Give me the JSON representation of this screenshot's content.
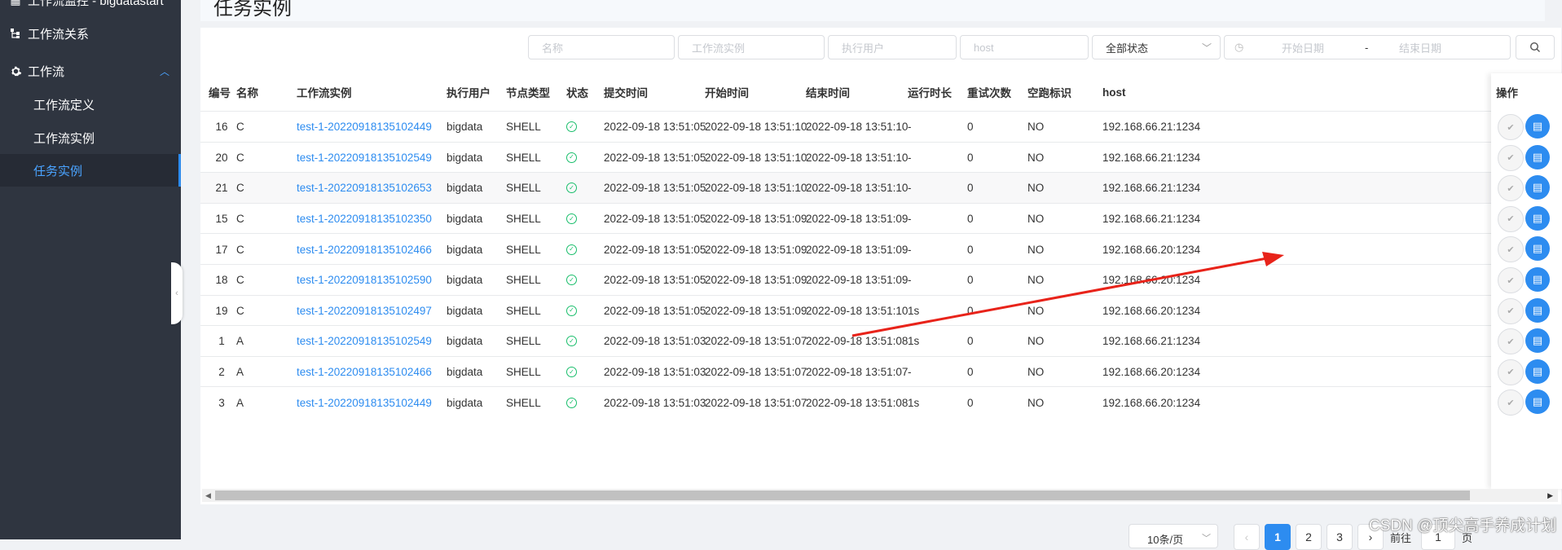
{
  "sidebar": {
    "top_partial": "工作流监控 - bigdatastart",
    "items": [
      {
        "label": "工作流关系",
        "icon": "relation-icon"
      },
      {
        "label": "工作流",
        "icon": "gear-icon"
      }
    ],
    "sub_items": [
      {
        "label": "工作流定义",
        "active": false
      },
      {
        "label": "工作流实例",
        "active": false
      },
      {
        "label": "任务实例",
        "active": true
      }
    ]
  },
  "page_title": "任务实例",
  "filters": {
    "name_placeholder": "名称",
    "process_instance_placeholder": "工作流实例",
    "executor_placeholder": "执行用户",
    "host_placeholder": "host",
    "state_select": "全部状态",
    "start_date_placeholder": "开始日期",
    "date_separator": "-",
    "end_date_placeholder": "结束日期"
  },
  "table": {
    "headers": [
      "编号",
      "名称",
      "工作流实例",
      "执行用户",
      "节点类型",
      "状态",
      "提交时间",
      "开始时间",
      "结束时间",
      "运行时长",
      "重试次数",
      "空跑标识",
      "host",
      "操作"
    ],
    "rows": [
      {
        "id": "16",
        "name": "C",
        "instance": "test-1-20220918135102449",
        "user": "bigdata",
        "type": "SHELL",
        "submit": "2022-09-18 13:51:05",
        "start": "2022-09-18 13:51:10",
        "end": "2022-09-18 13:51:10",
        "duration": "-",
        "retry": "0",
        "dry": "NO",
        "host": "192.168.66.21:1234"
      },
      {
        "id": "20",
        "name": "C",
        "instance": "test-1-20220918135102549",
        "user": "bigdata",
        "type": "SHELL",
        "submit": "2022-09-18 13:51:05",
        "start": "2022-09-18 13:51:10",
        "end": "2022-09-18 13:51:10",
        "duration": "-",
        "retry": "0",
        "dry": "NO",
        "host": "192.168.66.21:1234"
      },
      {
        "id": "21",
        "name": "C",
        "instance": "test-1-20220918135102653",
        "user": "bigdata",
        "type": "SHELL",
        "submit": "2022-09-18 13:51:05",
        "start": "2022-09-18 13:51:10",
        "end": "2022-09-18 13:51:10",
        "duration": "-",
        "retry": "0",
        "dry": "NO",
        "host": "192.168.66.21:1234"
      },
      {
        "id": "15",
        "name": "C",
        "instance": "test-1-20220918135102350",
        "user": "bigdata",
        "type": "SHELL",
        "submit": "2022-09-18 13:51:05",
        "start": "2022-09-18 13:51:09",
        "end": "2022-09-18 13:51:09",
        "duration": "-",
        "retry": "0",
        "dry": "NO",
        "host": "192.168.66.21:1234"
      },
      {
        "id": "17",
        "name": "C",
        "instance": "test-1-20220918135102466",
        "user": "bigdata",
        "type": "SHELL",
        "submit": "2022-09-18 13:51:05",
        "start": "2022-09-18 13:51:09",
        "end": "2022-09-18 13:51:09",
        "duration": "-",
        "retry": "0",
        "dry": "NO",
        "host": "192.168.66.20:1234"
      },
      {
        "id": "18",
        "name": "C",
        "instance": "test-1-20220918135102590",
        "user": "bigdata",
        "type": "SHELL",
        "submit": "2022-09-18 13:51:05",
        "start": "2022-09-18 13:51:09",
        "end": "2022-09-18 13:51:09",
        "duration": "-",
        "retry": "0",
        "dry": "NO",
        "host": "192.168.66.20:1234"
      },
      {
        "id": "19",
        "name": "C",
        "instance": "test-1-20220918135102497",
        "user": "bigdata",
        "type": "SHELL",
        "submit": "2022-09-18 13:51:05",
        "start": "2022-09-18 13:51:09",
        "end": "2022-09-18 13:51:10",
        "duration": "1s",
        "retry": "0",
        "dry": "NO",
        "host": "192.168.66.20:1234"
      },
      {
        "id": "1",
        "name": "A",
        "instance": "test-1-20220918135102549",
        "user": "bigdata",
        "type": "SHELL",
        "submit": "2022-09-18 13:51:03",
        "start": "2022-09-18 13:51:07",
        "end": "2022-09-18 13:51:08",
        "duration": "1s",
        "retry": "0",
        "dry": "NO",
        "host": "192.168.66.21:1234"
      },
      {
        "id": "2",
        "name": "A",
        "instance": "test-1-20220918135102466",
        "user": "bigdata",
        "type": "SHELL",
        "submit": "2022-09-18 13:51:03",
        "start": "2022-09-18 13:51:07",
        "end": "2022-09-18 13:51:07",
        "duration": "-",
        "retry": "0",
        "dry": "NO",
        "host": "192.168.66.20:1234"
      },
      {
        "id": "3",
        "name": "A",
        "instance": "test-1-20220918135102449",
        "user": "bigdata",
        "type": "SHELL",
        "submit": "2022-09-18 13:51:03",
        "start": "2022-09-18 13:51:07",
        "end": "2022-09-18 13:51:08",
        "duration": "1s",
        "retry": "0",
        "dry": "NO",
        "host": "192.168.66.20:1234"
      }
    ]
  },
  "pagination": {
    "page_size": "10条/页",
    "pages": [
      "1",
      "2",
      "3"
    ],
    "current": "1",
    "goto_label": "前往",
    "goto_value": "1",
    "page_suffix": "页"
  },
  "watermark": "CSDN @顶尖高手养成计划",
  "colors": {
    "accent": "#2d8cf0",
    "success": "#19be6b",
    "sidebar": "#2f3540",
    "annotation_arrow": "#e8231a"
  }
}
